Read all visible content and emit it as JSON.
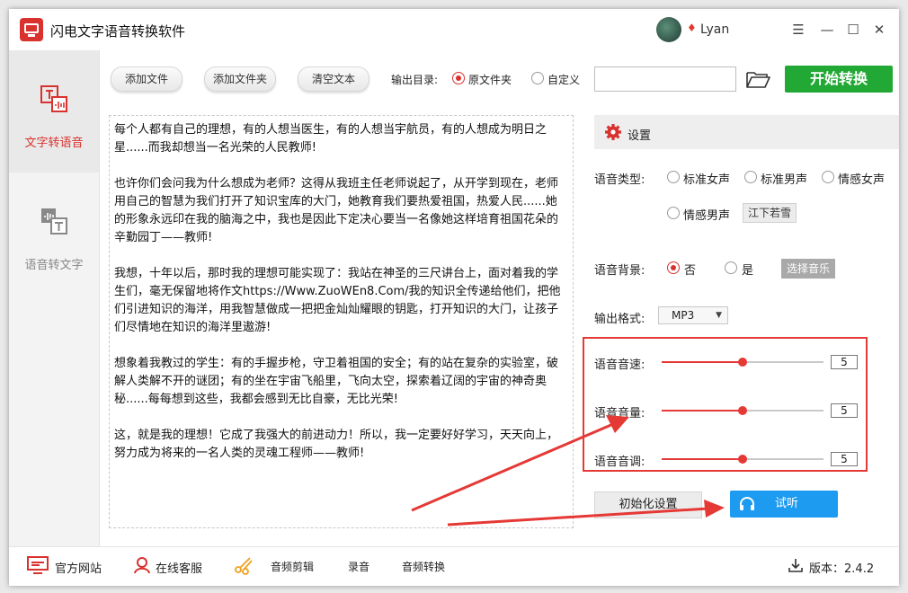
{
  "app": {
    "title": "闪电文字语音转换软件",
    "username": "Lyan"
  },
  "window_controls": {
    "menu": "☰",
    "minimize": "—",
    "maximize": "☐",
    "close": "✕"
  },
  "sidebar": {
    "items": [
      {
        "label": "文字转语音",
        "active": true
      },
      {
        "label": "语音转文字",
        "active": false
      }
    ]
  },
  "toolbar": {
    "add_file": "添加文件",
    "add_folder": "添加文件夹",
    "clear_text": "清空文本",
    "output_dir_label": "输出目录:",
    "option_source": "原文件夹",
    "option_custom": "自定义",
    "output_path": "",
    "start": "开始转换"
  },
  "text_content": [
    "每个人都有自己的理想，有的人想当医生，有的人想当宇航员，有的人想成为明日之星......而我却想当一名光荣的人民教师!",
    "也许你们会问我为什么想成为老师？这得从我班主任老师说起了，从开学到现在，老师用自己的智慧为我们打开了知识宝库的大门，她教育我们要热爱祖国，热爱人民......她的形象永远印在我的脑海之中，我也是因此下定决心要当一名像她这样培育祖国花朵的辛勤园丁——教师!",
    "我想，十年以后，那时我的理想可能实现了：我站在神圣的三尺讲台上，面对着我的学生们，毫无保留地将作文https://Www.ZuoWEn8.Com/我的知识全传递给他们，把他们引进知识的海洋，用我智慧做成一把把金灿灿耀眼的钥匙，打开知识的大门，让孩子们尽情地在知识的海洋里遨游!",
    "想象着我教过的学生：有的手握步枪，守卫着祖国的安全；有的站在复杂的实验室，破解人类解不开的谜团；有的坐在宇宙飞船里，飞向太空，探索着辽阔的宇宙的神奇奥秘......每每想到这些，我都会感到无比自豪，无比光荣!",
    "这，就是我的理想！它成了我强大的前进动力！所以，我一定要好好学习，天天向上，努力成为将来的一名人类的灵魂工程师——教师!"
  ],
  "settings": {
    "title": "设置",
    "voice_type_label": "语音类型:",
    "voice_options": [
      "标准女声",
      "标准男声",
      "情感女声",
      "情感男声"
    ],
    "voice_selected_name": "江下若雪",
    "bg_label": "语音背景:",
    "bg_no": "否",
    "bg_yes": "是",
    "choose_music": "选择音乐",
    "format_label": "输出格式:",
    "format_value": "MP3",
    "speed_label": "语音音速:",
    "speed_value": "5",
    "speed_level": 0.5,
    "volume_label": "语音音量:",
    "volume_value": "5",
    "volume_level": 0.5,
    "pitch_label": "语音音调:",
    "pitch_value": "5",
    "pitch_level": 0.5,
    "reset": "初始化设置",
    "listen": "试听"
  },
  "footer": {
    "website": "官方网站",
    "support": "在线客服",
    "audio_cut": "音频剪辑",
    "record": "录音",
    "audio_convert": "音频转换",
    "version_label": "版本：",
    "version": "2.4.2"
  },
  "colors": {
    "accent": "#d9322e",
    "start": "#22a834",
    "listen": "#1d9bf0",
    "highlight": "#e53935"
  }
}
